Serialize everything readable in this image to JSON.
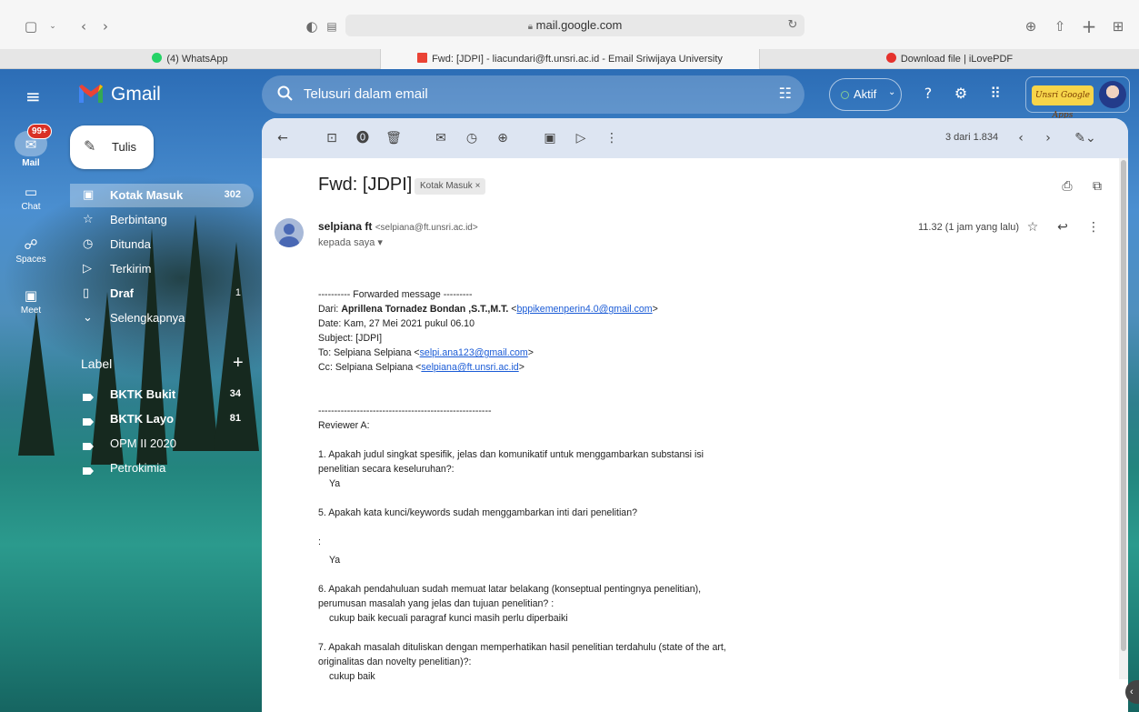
{
  "browser": {
    "url": "mail.google.com",
    "tabs": [
      {
        "title": "(4) WhatsApp",
        "color": "#25d366"
      },
      {
        "title": "Fwd: [JDPI] - liacundari@ft.unsri.ac.id - Email Sriwijaya University",
        "color": "#ea4335"
      },
      {
        "title": "Download file | iLovePDF",
        "color": "#e5322d"
      }
    ]
  },
  "gmail": {
    "app_name": "Gmail",
    "search_placeholder": "Telusuri dalam email",
    "status": "Aktif",
    "org_logo_text": "Unsri Google Apps"
  },
  "rail": {
    "mail_badge": "99+",
    "items": [
      "Mail",
      "Chat",
      "Spaces",
      "Meet"
    ]
  },
  "sidenav": {
    "compose": "Tulis",
    "items": [
      {
        "label": "Kotak Masuk",
        "count": "302",
        "icon": "inbox-icon"
      },
      {
        "label": "Berbintang",
        "count": "",
        "icon": "star-icon"
      },
      {
        "label": "Ditunda",
        "count": "",
        "icon": "clock-icon"
      },
      {
        "label": "Terkirim",
        "count": "",
        "icon": "send-icon"
      },
      {
        "label": "Draf",
        "count": "1",
        "icon": "draft-icon"
      },
      {
        "label": "Selengkapnya",
        "count": "",
        "icon": "chevron-down-icon"
      }
    ],
    "label_heading": "Label",
    "labels": [
      {
        "label": "BKTK Bukit",
        "count": "34"
      },
      {
        "label": "BKTK Layo",
        "count": "81"
      },
      {
        "label": "OPM II 2020",
        "count": ""
      },
      {
        "label": "Petrokimia",
        "count": ""
      }
    ]
  },
  "message": {
    "pager": "3 dari 1.834",
    "subject": "Fwd: [JDPI]",
    "inbox_chip": "Kotak Masuk ×",
    "sender_name": "selpiana ft",
    "sender_email": "<selpiana@ft.unsri.ac.id>",
    "to": "kepada saya ▾",
    "time": "11.32 (1 jam yang lalu)",
    "body": {
      "fwd_header": "---------- Forwarded message ---------",
      "from_prefix": "Dari: ",
      "from_name": "Aprillena Tornadez Bondan ,S.T.,M.T.",
      "from_lt": " <",
      "from_email": "bppikemenperin4.0@gmail.com",
      "from_gt": ">",
      "date": "Date: Kam, 27 Mei 2021 pukul 06.10",
      "subject_line": "Subject: [JDPI]",
      "to_prefix": "To: Selpiana Selpiana <",
      "to_email": "selpi.ana123@gmail.com",
      "to_suffix": ">",
      "cc_prefix": "Cc: Selpiana Selpiana <",
      "cc_email": "selpiana@ft.unsri.ac.id",
      "cc_suffix": ">",
      "separator": "------------------------------------------------------",
      "reviewer": "Reviewer A:",
      "q1": "1. Apakah judul singkat spesifik, jelas dan komunikatif untuk menggambarkan substansi isi penelitian secara keseluruhan?:",
      "a1": "Ya",
      "q5": "5. Apakah kata kunci/keywords sudah menggambarkan inti dari penelitian?",
      "colon": ":",
      "a5": "Ya",
      "q6": "6.  Apakah pendahuluan sudah memuat latar belakang (konseptual pentingnya penelitian), perumusan masalah yang jelas dan tujuan penelitian? :",
      "a6": "cukup baik kecuali paragraf kunci masih perlu diperbaiki",
      "q7": "7. Apakah masalah dituliskan dengan memperhatikan hasil penelitian terdahulu (state of the art, originalitas dan novelty penelitian)?:",
      "a7": "cukup baik"
    }
  }
}
